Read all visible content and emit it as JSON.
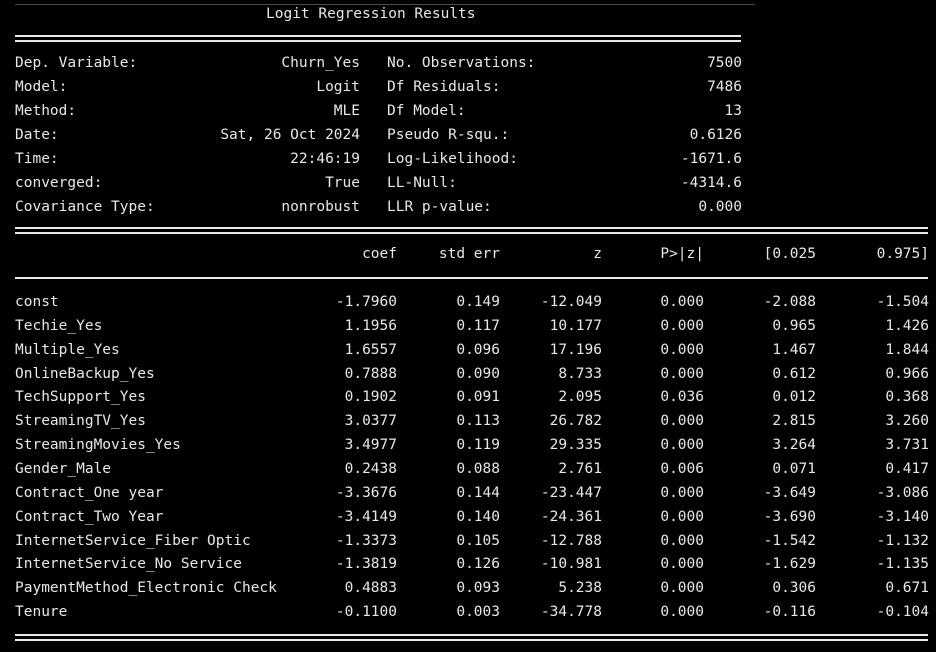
{
  "title": "Logit Regression Results",
  "summary": {
    "left": [
      {
        "label": "Dep. Variable:",
        "value": "Churn_Yes"
      },
      {
        "label": "Model:",
        "value": "Logit"
      },
      {
        "label": "Method:",
        "value": "MLE"
      },
      {
        "label": "Date:",
        "value": "Sat, 26 Oct 2024"
      },
      {
        "label": "Time:",
        "value": "22:46:19"
      },
      {
        "label": "converged:",
        "value": "True"
      },
      {
        "label": "Covariance Type:",
        "value": "nonrobust"
      }
    ],
    "right": [
      {
        "label": "No. Observations:",
        "value": "7500"
      },
      {
        "label": "Df Residuals:",
        "value": "7486"
      },
      {
        "label": "Df Model:",
        "value": "13"
      },
      {
        "label": "Pseudo R-squ.:",
        "value": "0.6126"
      },
      {
        "label": "Log-Likelihood:",
        "value": "-1671.6"
      },
      {
        "label": "LL-Null:",
        "value": "-4314.6"
      },
      {
        "label": "LLR p-value:",
        "value": "0.000"
      }
    ]
  },
  "coef_table": {
    "headers": [
      "coef",
      "std err",
      "z",
      "P>|z|",
      "[0.025",
      "0.975]"
    ],
    "rows": [
      {
        "name": "const",
        "values": [
          "-1.7960",
          "0.149",
          "-12.049",
          "0.000",
          "-2.088",
          "-1.504"
        ]
      },
      {
        "name": "Techie_Yes",
        "values": [
          "1.1956",
          "0.117",
          "10.177",
          "0.000",
          "0.965",
          "1.426"
        ]
      },
      {
        "name": "Multiple_Yes",
        "values": [
          "1.6557",
          "0.096",
          "17.196",
          "0.000",
          "1.467",
          "1.844"
        ]
      },
      {
        "name": "OnlineBackup_Yes",
        "values": [
          "0.7888",
          "0.090",
          "8.733",
          "0.000",
          "0.612",
          "0.966"
        ]
      },
      {
        "name": "TechSupport_Yes",
        "values": [
          "0.1902",
          "0.091",
          "2.095",
          "0.036",
          "0.012",
          "0.368"
        ]
      },
      {
        "name": "StreamingTV_Yes",
        "values": [
          "3.0377",
          "0.113",
          "26.782",
          "0.000",
          "2.815",
          "3.260"
        ]
      },
      {
        "name": "StreamingMovies_Yes",
        "values": [
          "3.4977",
          "0.119",
          "29.335",
          "0.000",
          "3.264",
          "3.731"
        ]
      },
      {
        "name": "Gender_Male",
        "values": [
          "0.2438",
          "0.088",
          "2.761",
          "0.006",
          "0.071",
          "0.417"
        ]
      },
      {
        "name": "Contract_One year",
        "values": [
          "-3.3676",
          "0.144",
          "-23.447",
          "0.000",
          "-3.649",
          "-3.086"
        ]
      },
      {
        "name": "Contract_Two Year",
        "values": [
          "-3.4149",
          "0.140",
          "-24.361",
          "0.000",
          "-3.690",
          "-3.140"
        ]
      },
      {
        "name": "InternetService_Fiber Optic",
        "values": [
          "-1.3373",
          "0.105",
          "-12.788",
          "0.000",
          "-1.542",
          "-1.132"
        ]
      },
      {
        "name": "InternetService_No Service",
        "values": [
          "-1.3819",
          "0.126",
          "-10.981",
          "0.000",
          "-1.629",
          "-1.135"
        ]
      },
      {
        "name": "PaymentMethod_Electronic Check",
        "values": [
          "0.4883",
          "0.093",
          "5.238",
          "0.000",
          "0.306",
          "0.671"
        ]
      },
      {
        "name": "Tenure",
        "values": [
          "-0.1100",
          "0.003",
          "-34.778",
          "0.000",
          "-0.116",
          "-0.104"
        ]
      }
    ]
  }
}
